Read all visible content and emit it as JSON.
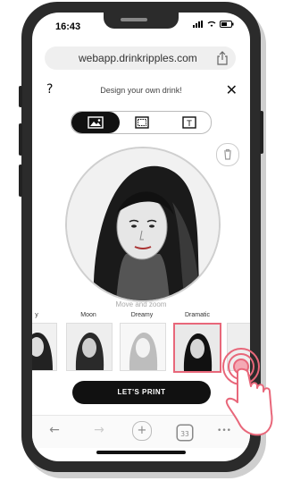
{
  "status": {
    "time": "16:43"
  },
  "browser": {
    "url": "webapp.drinkripples.com"
  },
  "header": {
    "help": "?",
    "title": "Design your own drink!",
    "close": "✕"
  },
  "modes": {
    "active": "image",
    "items": [
      "image",
      "frame",
      "text"
    ],
    "text_glyph": "T"
  },
  "editor": {
    "hint": "Move and zoom"
  },
  "filters": {
    "selected": "Dramatic",
    "items": [
      {
        "label": "y"
      },
      {
        "label": "Moon"
      },
      {
        "label": "Dreamy"
      },
      {
        "label": "Dramatic"
      }
    ]
  },
  "actions": {
    "print_label": "LET'S PRINT"
  },
  "toolbar": {
    "back": "←",
    "forward": "→",
    "new_tab": "+",
    "more": "•••"
  },
  "colors": {
    "accent": "#e8677a",
    "button_dark": "#111111"
  }
}
